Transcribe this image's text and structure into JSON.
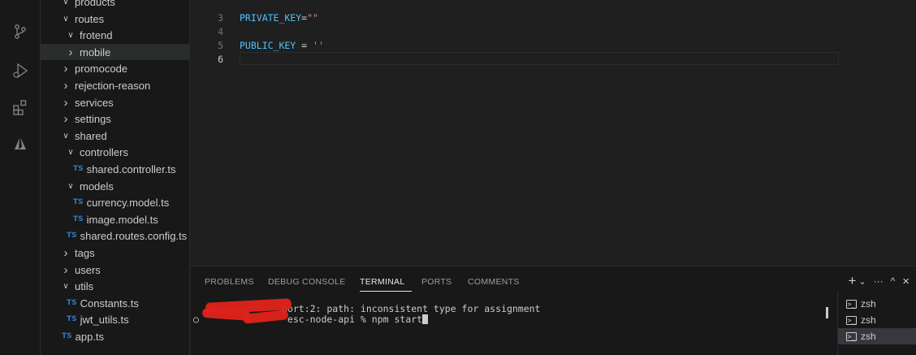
{
  "activity_bar": {
    "icons": [
      "source-control-icon",
      "run-debug-icon",
      "extensions-icon",
      "azure-icon"
    ]
  },
  "explorer": {
    "items": [
      {
        "label": "products",
        "type": "folder",
        "expanded": true,
        "indent": 0
      },
      {
        "label": "routes",
        "type": "folder",
        "expanded": true,
        "indent": 0
      },
      {
        "label": "frotend",
        "type": "folder",
        "expanded": true,
        "indent": 1
      },
      {
        "label": "mobile",
        "type": "folder",
        "expanded": false,
        "indent": 1
      },
      {
        "label": "promocode",
        "type": "folder",
        "expanded": false,
        "indent": 0
      },
      {
        "label": "rejection-reason",
        "type": "folder",
        "expanded": false,
        "indent": 0
      },
      {
        "label": "services",
        "type": "folder",
        "expanded": false,
        "indent": 0
      },
      {
        "label": "settings",
        "type": "folder",
        "expanded": false,
        "indent": 0
      },
      {
        "label": "shared",
        "type": "folder",
        "expanded": true,
        "indent": 0
      },
      {
        "label": "controllers",
        "type": "folder",
        "expanded": true,
        "indent": 1
      },
      {
        "label": "shared.controller.ts",
        "type": "ts",
        "indent": 2
      },
      {
        "label": "models",
        "type": "folder",
        "expanded": true,
        "indent": 1
      },
      {
        "label": "currency.model.ts",
        "type": "ts",
        "indent": 2
      },
      {
        "label": "image.model.ts",
        "type": "ts",
        "indent": 2
      },
      {
        "label": "shared.routes.config.ts",
        "type": "ts",
        "indent": 1
      },
      {
        "label": "tags",
        "type": "folder",
        "expanded": false,
        "indent": 0
      },
      {
        "label": "users",
        "type": "folder",
        "expanded": false,
        "indent": 0
      },
      {
        "label": "utils",
        "type": "folder",
        "expanded": true,
        "indent": 0
      },
      {
        "label": "Constants.ts",
        "type": "ts",
        "indent": 1
      },
      {
        "label": "jwt_utils.ts",
        "type": "ts",
        "indent": 1
      },
      {
        "label": "app.ts",
        "type": "ts",
        "indent": 0
      }
    ],
    "ts_badge": "TS"
  },
  "editor": {
    "lines": [
      {
        "num": "3",
        "var": "PRIVATE_KEY",
        "op": "=",
        "str": "\"\""
      },
      {
        "num": "4",
        "var": "",
        "op": "",
        "str": ""
      },
      {
        "num": "5",
        "var": "PUBLIC_KEY",
        "op": " = ",
        "str": "''"
      },
      {
        "num": "6",
        "var": "",
        "op": "",
        "str": ""
      }
    ]
  },
  "panel": {
    "tabs": [
      "PROBLEMS",
      "DEBUG CONSOLE",
      "TERMINAL",
      "PORTS",
      "COMMENTS"
    ],
    "active_tab": "TERMINAL",
    "actions": {
      "add": "+",
      "dropdown": "⌄",
      "more": "···",
      "maximize": "^",
      "close": "×"
    },
    "terminal": {
      "line1": "port:2: path: inconsistent type for assignment",
      "prompt_mark": "○",
      "line2": " esc-node-api % npm start"
    },
    "terminals": [
      "zsh",
      "zsh",
      "zsh"
    ],
    "terminal_icon": ">_"
  }
}
